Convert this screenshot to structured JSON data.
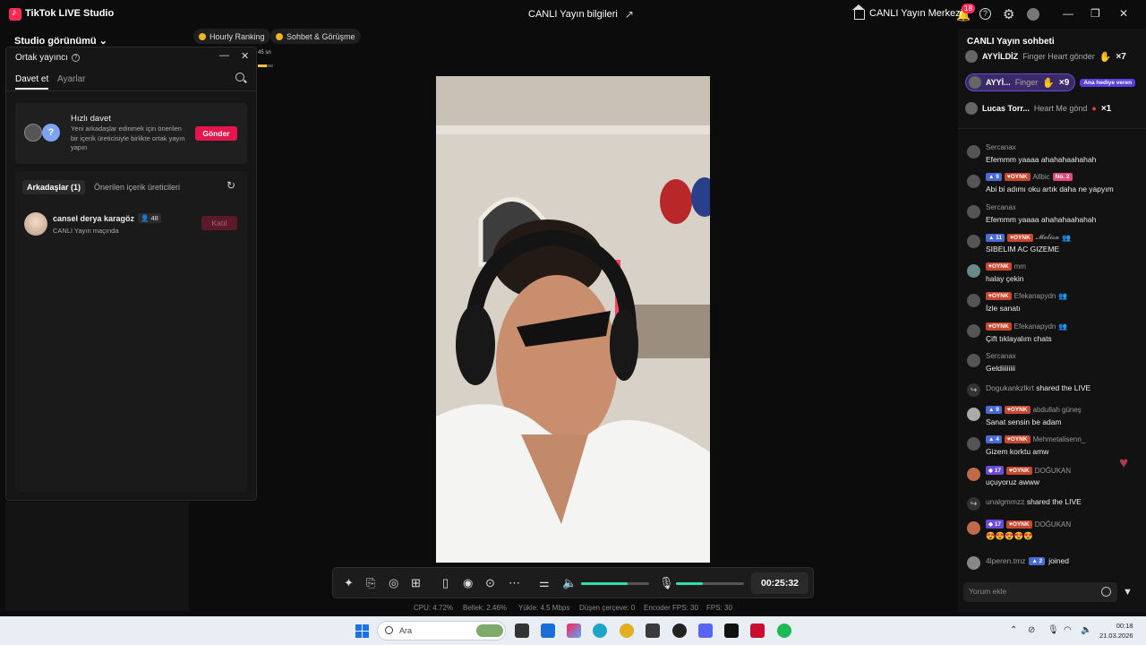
{
  "titlebar": {
    "app_title": "TikTok LIVE Studio",
    "center_title": "CANLI Yayın bilgileri",
    "center_btn": "CANLI Yayın Merkezi",
    "notif_count": "18",
    "help": "?",
    "minimize": "—",
    "maximize": "❐",
    "close": "✕"
  },
  "left": {
    "studio_view": "Studio görünümü",
    "panel_title": "Ortak yayıncı",
    "tabs": [
      "Davet et",
      "Ayarlar"
    ],
    "quick": {
      "title": "Hızlı davet",
      "desc": "Yeni arkadaşlar edinmek için önerilen bir içerik üreticisiyle birlikte ortak yayın yapın",
      "button": "Gönder",
      "avatar_q": "?"
    },
    "friend_tabs": [
      "Arkadaşlar (1)",
      "Önerilen içerik üreticileri"
    ],
    "friend": {
      "name": "cansel derya karagöz",
      "count": "48",
      "status": "CANLI Yayın maçında",
      "button": "Katıl"
    }
  },
  "pills": [
    "Hourly Ranking",
    "Sohbet & Görüşme"
  ],
  "mini_timer": "45 sn",
  "controls": {
    "timer": "00:25:32",
    "volume": 0.68,
    "mic": 0.4
  },
  "stats": [
    "CPU: 4.72%",
    "Bellek: 2.46%",
    "Yükle: 4.5 Mbps",
    "Düşen çerçeve: 0",
    "Encoder FPS: 30",
    "FPS: 30"
  ],
  "chat": {
    "title": "CANLI Yayın sohbeti",
    "gifts": [
      {
        "user": "AYYİLDİZ",
        "text": "Finger Heart gönder",
        "mult": "×7"
      },
      {
        "user": "AYYİ...",
        "text": "Finger",
        "mult": "×9",
        "tag": "Ana hediye veren"
      },
      {
        "user": "Lucas Torr...",
        "text": "Heart Me gönd",
        "mult": "×1"
      }
    ],
    "messages": [
      {
        "user": "Sercanax",
        "text": "Efemmm yaaaa ahahahaahahah"
      },
      {
        "level": "9",
        "fan": "OYNK",
        "user": "Allbic",
        "rank": "No. 2",
        "text": "Abi bi adımı oku artık daha ne yapyım"
      },
      {
        "user": "Sercanax",
        "text": "Efemmm yaaaa ahahahaahahah"
      },
      {
        "level": "11",
        "fan": "OYNK",
        "user": "𝓜𝓮𝓵𝓲𝓼𝓪",
        "text": "SIBELIM AC GIZEME"
      },
      {
        "fan": "OYNK",
        "user": "mm",
        "text": "halay çekin"
      },
      {
        "fan": "OYNK",
        "user": "Efekanapydn",
        "text": "İzle sanatı"
      },
      {
        "fan": "OYNK",
        "user": "Efekanapydn",
        "text": "Çift tıklayalım chats"
      },
      {
        "user": "Sercanax",
        "text": "Geldiiiiiiii"
      },
      {
        "share_user": "Dogukankzlkrt",
        "share_text": "shared the LIVE"
      },
      {
        "level": "9",
        "fan": "OYNK",
        "user": "abdullah güneş",
        "text": "Sanat sensin be adam"
      },
      {
        "level": "4",
        "fan": "OYNK",
        "user": "Mehmetalisenn_",
        "text": "Gizem korktu amw"
      },
      {
        "level": "17",
        "fan": "OYNK",
        "user": "DOĞUKAN",
        "text": "uçuyoruz awww"
      },
      {
        "share_user": "unalgmmzz",
        "share_text": "shared the LIVE"
      },
      {
        "level": "17",
        "fan": "OYNK",
        "user": "DOĞUKAN",
        "text": "😍😍😍😍😍"
      },
      {
        "join_user": "4lperen.tmz",
        "level": "2",
        "join_text": "joined"
      }
    ],
    "comment_placeholder": "Yorum ekle"
  },
  "taskbar": {
    "search": "Ara",
    "time": "00:18",
    "date": "21.03.2026"
  }
}
